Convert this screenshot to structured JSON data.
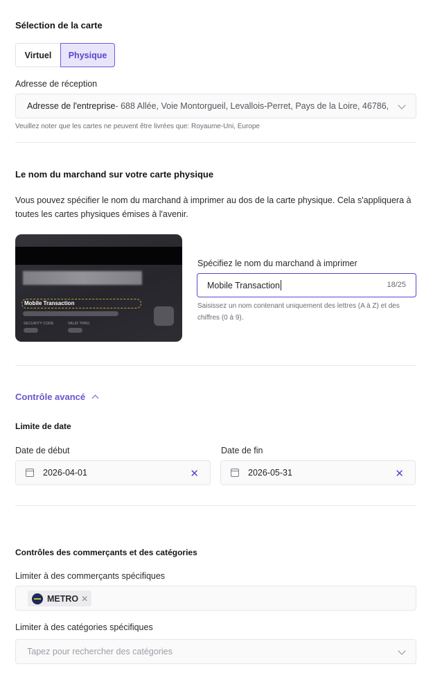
{
  "card_selection": {
    "title": "Sélection de la carte",
    "options": [
      "Virtuel",
      "Physique"
    ],
    "selected": "Physique"
  },
  "address": {
    "label": "Adresse de réception",
    "value_prefix": "Adresse de l'entreprise",
    "value_rest": "- 688 Allée, Voie Montorgueil, Levallois-Perret, Pays de la Loire, 46786,",
    "note": "Veuillez noter que les cartes ne peuvent être livrées que: Royaume-Uni, Europe"
  },
  "merchant_section": {
    "title": "Le nom du marchand sur votre carte physique",
    "description_line1": "Vous pouvez spécifier le nom du marchand à imprimer au dos de la carte physique. Cela s'appliquera à",
    "description_line2": "toutes les cartes physiques émises à l'avenir.",
    "card": {
      "merchant_name": "Mobile Transaction",
      "security_code_label": "SECURITY CODE",
      "valid_thru_label": "VALID THRU"
    },
    "input_label": "Spécifiez le nom du marchand à imprimer",
    "input_value": "Mobile Transaction",
    "counter": "18/25",
    "help_line1": "Saisissez un nom contenant uniquement des lettres (A à Z) et des",
    "help_line2": "chiffres (0 à 9)."
  },
  "advanced": {
    "toggle_label": "Contrôle avancé",
    "date_limit": {
      "title": "Limite de date",
      "start_label": "Date de début",
      "start_value": "2026-04-01",
      "end_label": "Date de fin",
      "end_value": "2026-05-31"
    },
    "merchant_controls": {
      "title": "Contrôles des commerçants et des catégories",
      "merchants_label": "Limiter à des commerçants spécifiques",
      "merchant_tags": [
        "METRO"
      ],
      "categories_label": "Limiter à des catégories spécifiques",
      "categories_placeholder": "Tapez pour rechercher des catégories"
    }
  },
  "colors": {
    "accent": "#5b46c9",
    "accent_bg": "#e8e5fb"
  }
}
